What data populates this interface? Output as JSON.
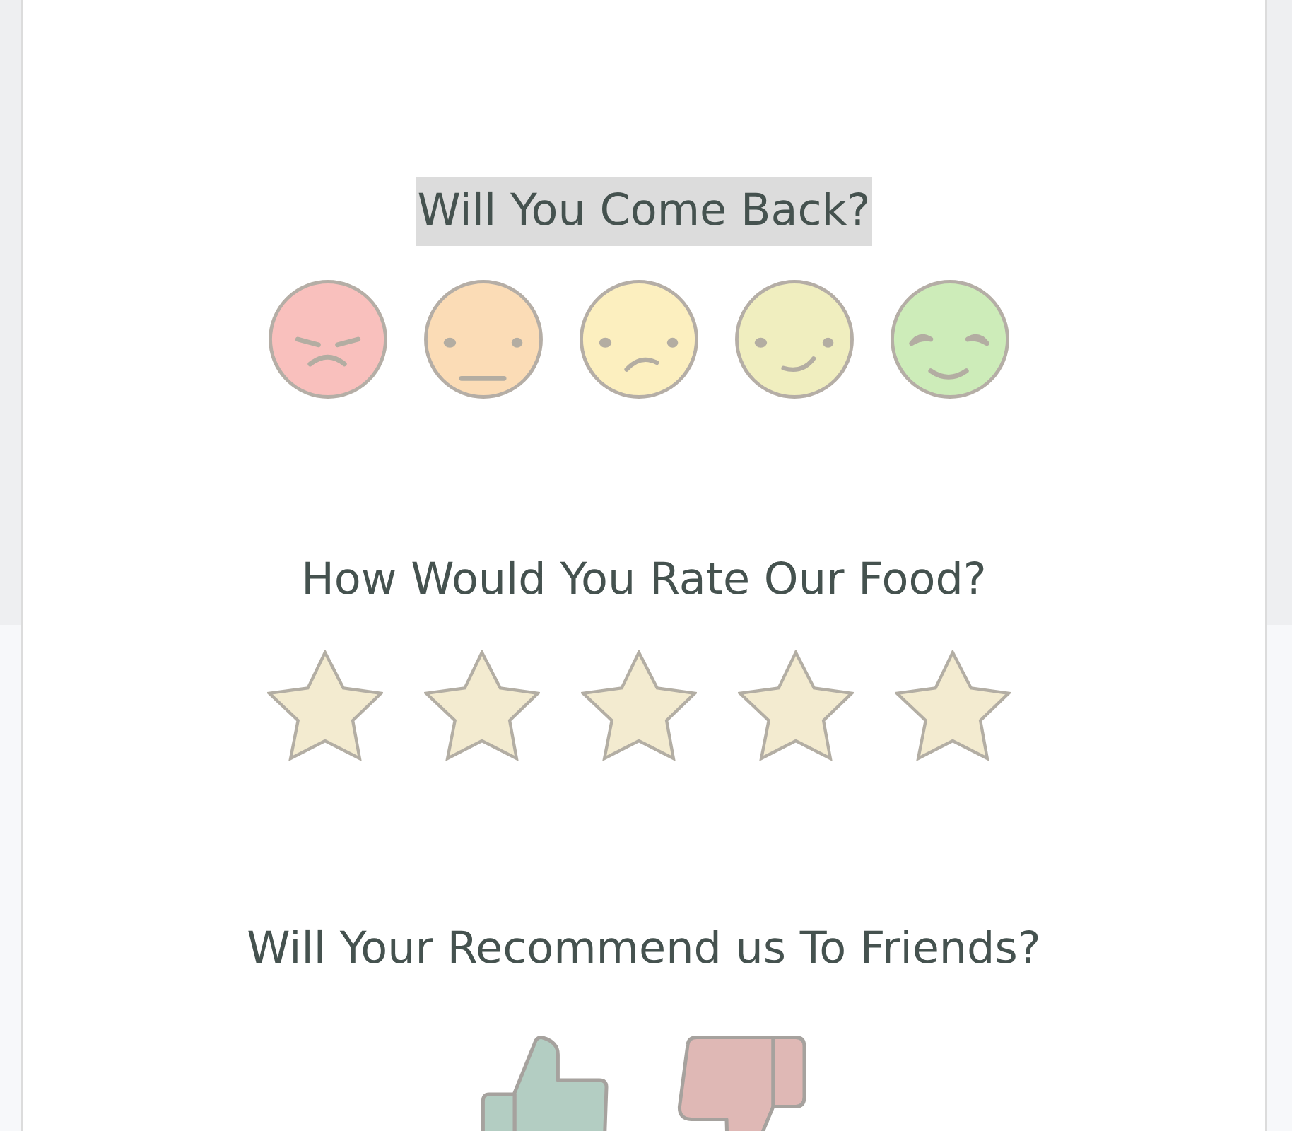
{
  "questions": [
    {
      "kind": "faces",
      "title": "Will You Come Back?",
      "highlighted": true,
      "options": [
        {
          "kind": "angry",
          "color": "#f9c0bd",
          "selected": false
        },
        {
          "kind": "neutral",
          "color": "#fbdcb6",
          "selected": false
        },
        {
          "kind": "frowning",
          "color": "#fcefbf",
          "selected": false
        },
        {
          "kind": "smiling",
          "color": "#f0eebf",
          "selected": false
        },
        {
          "kind": "happy",
          "color": "#cdecb9",
          "selected": false
        }
      ]
    },
    {
      "kind": "stars",
      "title": "How Would You Rate Our Food?",
      "highlighted": false,
      "stars": 5
    },
    {
      "kind": "thumbs",
      "title": "Will Your Recommend us To Friends?",
      "highlighted": false,
      "options": [
        {
          "kind": "up",
          "color": "#b3cdc2",
          "selected": false
        },
        {
          "kind": "down",
          "color": "#dfb8b5",
          "selected": false
        }
      ]
    }
  ]
}
